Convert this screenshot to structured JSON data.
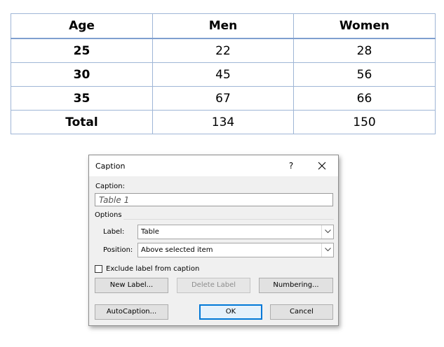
{
  "table": {
    "headers": [
      "Age",
      "Men",
      "Women"
    ],
    "rows": [
      [
        "25",
        "22",
        "28"
      ],
      [
        "30",
        "45",
        "56"
      ],
      [
        "35",
        "67",
        "66"
      ],
      [
        "Total",
        "134",
        "150"
      ]
    ]
  },
  "dialog": {
    "title": "Caption",
    "help": "?",
    "caption_label": "Caption:",
    "caption_value": "Table 1",
    "options_label": "Options",
    "label_label": "Label:",
    "label_value": "Table",
    "position_label": "Position:",
    "position_value": "Above selected item",
    "exclude_label": "Exclude label from caption",
    "exclude_checked": false,
    "buttons": {
      "new_label": "New Label...",
      "delete_label": "Delete Label",
      "numbering": "Numbering...",
      "autocaption": "AutoCaption...",
      "ok": "OK",
      "cancel": "Cancel"
    }
  },
  "colors": {
    "table_border": "#9fb6d6",
    "dialog_bg": "#f0f0f0",
    "default_button_border": "#0078d7"
  },
  "icons": [
    "close-icon",
    "chevron-down-icon"
  ]
}
